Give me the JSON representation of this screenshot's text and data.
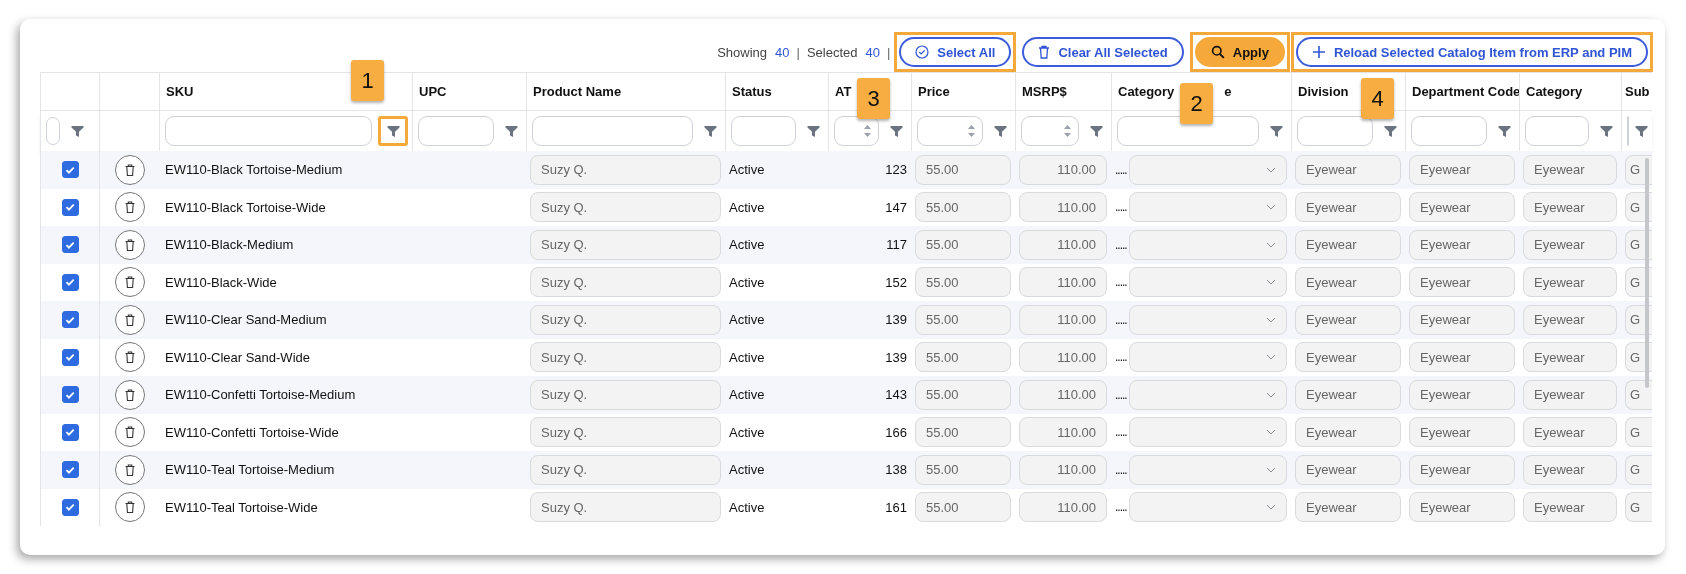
{
  "toolbar": {
    "showing_label": "Showing",
    "showing_count": "40",
    "selected_label": "Selected",
    "selected_count": "40",
    "separator": "|",
    "buttons": [
      {
        "kind": "select",
        "label": "Select All",
        "highlighted": true
      },
      {
        "kind": "clear",
        "label": "Clear All Selected",
        "highlighted": false
      },
      {
        "kind": "apply",
        "label": "Apply",
        "highlighted": true
      },
      {
        "kind": "reload",
        "label": "Reload Selected Catalog Item from ERP and PIM",
        "highlighted": true
      }
    ]
  },
  "table": {
    "columns": [
      {
        "kind": "checkbox",
        "filter_highlighted": false
      },
      {
        "kind": "action"
      },
      {
        "kind": "text",
        "label": "SKU",
        "filter_highlighted": true
      },
      {
        "kind": "text",
        "label": "UPC",
        "filter_highlighted": false
      },
      {
        "kind": "text",
        "label": "Product Name",
        "filter_highlighted": false
      },
      {
        "kind": "text",
        "label": "Status",
        "filter_highlighted": false
      },
      {
        "kind": "number",
        "label": "AT",
        "filter_highlighted": false
      },
      {
        "kind": "number",
        "label": "Price",
        "filter_highlighted": false
      },
      {
        "kind": "number",
        "label": "MSRP$",
        "filter_highlighted": false
      },
      {
        "kind": "text",
        "label": "Category",
        "label_tail": "e",
        "filter_highlighted": false
      },
      {
        "kind": "text",
        "label": "Division",
        "filter_highlighted": false
      },
      {
        "kind": "text",
        "label": "Department Code",
        "filter_highlighted": false
      },
      {
        "kind": "text",
        "label": "Category",
        "filter_highlighted": false
      },
      {
        "kind": "text",
        "label": "Sub",
        "filter_highlighted": false
      }
    ],
    "rows": [
      {
        "checked": true,
        "sku": "EW110-Black Tortoise-Medium",
        "product_name": "Suzy Q.",
        "status": "Active",
        "ats": "123",
        "price": "55.00",
        "msrp": "110.00",
        "category_code_prefix": ".....",
        "division": "Eyewear",
        "department_code": "Eyewear",
        "category": "Eyewear",
        "column_14": "G"
      },
      {
        "checked": true,
        "sku": "EW110-Black Tortoise-Wide",
        "product_name": "Suzy Q.",
        "status": "Active",
        "ats": "147",
        "price": "55.00",
        "msrp": "110.00",
        "category_code_prefix": ".....",
        "division": "Eyewear",
        "department_code": "Eyewear",
        "category": "Eyewear",
        "column_14": "G"
      },
      {
        "checked": true,
        "sku": "EW110-Black-Medium",
        "product_name": "Suzy Q.",
        "status": "Active",
        "ats": "117",
        "price": "55.00",
        "msrp": "110.00",
        "category_code_prefix": ".....",
        "division": "Eyewear",
        "department_code": "Eyewear",
        "category": "Eyewear",
        "column_14": "G"
      },
      {
        "checked": true,
        "sku": "EW110-Black-Wide",
        "product_name": "Suzy Q.",
        "status": "Active",
        "ats": "152",
        "price": "55.00",
        "msrp": "110.00",
        "category_code_prefix": ".....",
        "division": "Eyewear",
        "department_code": "Eyewear",
        "category": "Eyewear",
        "column_14": "G"
      },
      {
        "checked": true,
        "sku": "EW110-Clear Sand-Medium",
        "product_name": "Suzy Q.",
        "status": "Active",
        "ats": "139",
        "price": "55.00",
        "msrp": "110.00",
        "category_code_prefix": ".....",
        "division": "Eyewear",
        "department_code": "Eyewear",
        "category": "Eyewear",
        "column_14": "G"
      },
      {
        "checked": true,
        "sku": "EW110-Clear Sand-Wide",
        "product_name": "Suzy Q.",
        "status": "Active",
        "ats": "139",
        "price": "55.00",
        "msrp": "110.00",
        "category_code_prefix": ".....",
        "division": "Eyewear",
        "department_code": "Eyewear",
        "category": "Eyewear",
        "column_14": "G"
      },
      {
        "checked": true,
        "sku": "EW110-Confetti Tortoise-Medium",
        "product_name": "Suzy Q.",
        "status": "Active",
        "ats": "143",
        "price": "55.00",
        "msrp": "110.00",
        "category_code_prefix": ".....",
        "division": "Eyewear",
        "department_code": "Eyewear",
        "category": "Eyewear",
        "column_14": "G"
      },
      {
        "checked": true,
        "sku": "EW110-Confetti Tortoise-Wide",
        "product_name": "Suzy Q.",
        "status": "Active",
        "ats": "166",
        "price": "55.00",
        "msrp": "110.00",
        "category_code_prefix": ".....",
        "division": "Eyewear",
        "department_code": "Eyewear",
        "category": "Eyewear",
        "column_14": "G"
      },
      {
        "checked": true,
        "sku": "EW110-Teal Tortoise-Medium",
        "product_name": "Suzy Q.",
        "status": "Active",
        "ats": "138",
        "price": "55.00",
        "msrp": "110.00",
        "category_code_prefix": ".....",
        "division": "Eyewear",
        "department_code": "Eyewear",
        "category": "Eyewear",
        "column_14": "G"
      },
      {
        "checked": true,
        "sku": "EW110-Teal Tortoise-Wide",
        "product_name": "Suzy Q.",
        "status": "Active",
        "ats": "161",
        "price": "55.00",
        "msrp": "110.00",
        "category_code_prefix": ".....",
        "division": "Eyewear",
        "department_code": "Eyewear",
        "category": "Eyewear",
        "column_14": "G"
      }
    ]
  },
  "callouts": [
    "1",
    "3",
    "2",
    "4"
  ]
}
